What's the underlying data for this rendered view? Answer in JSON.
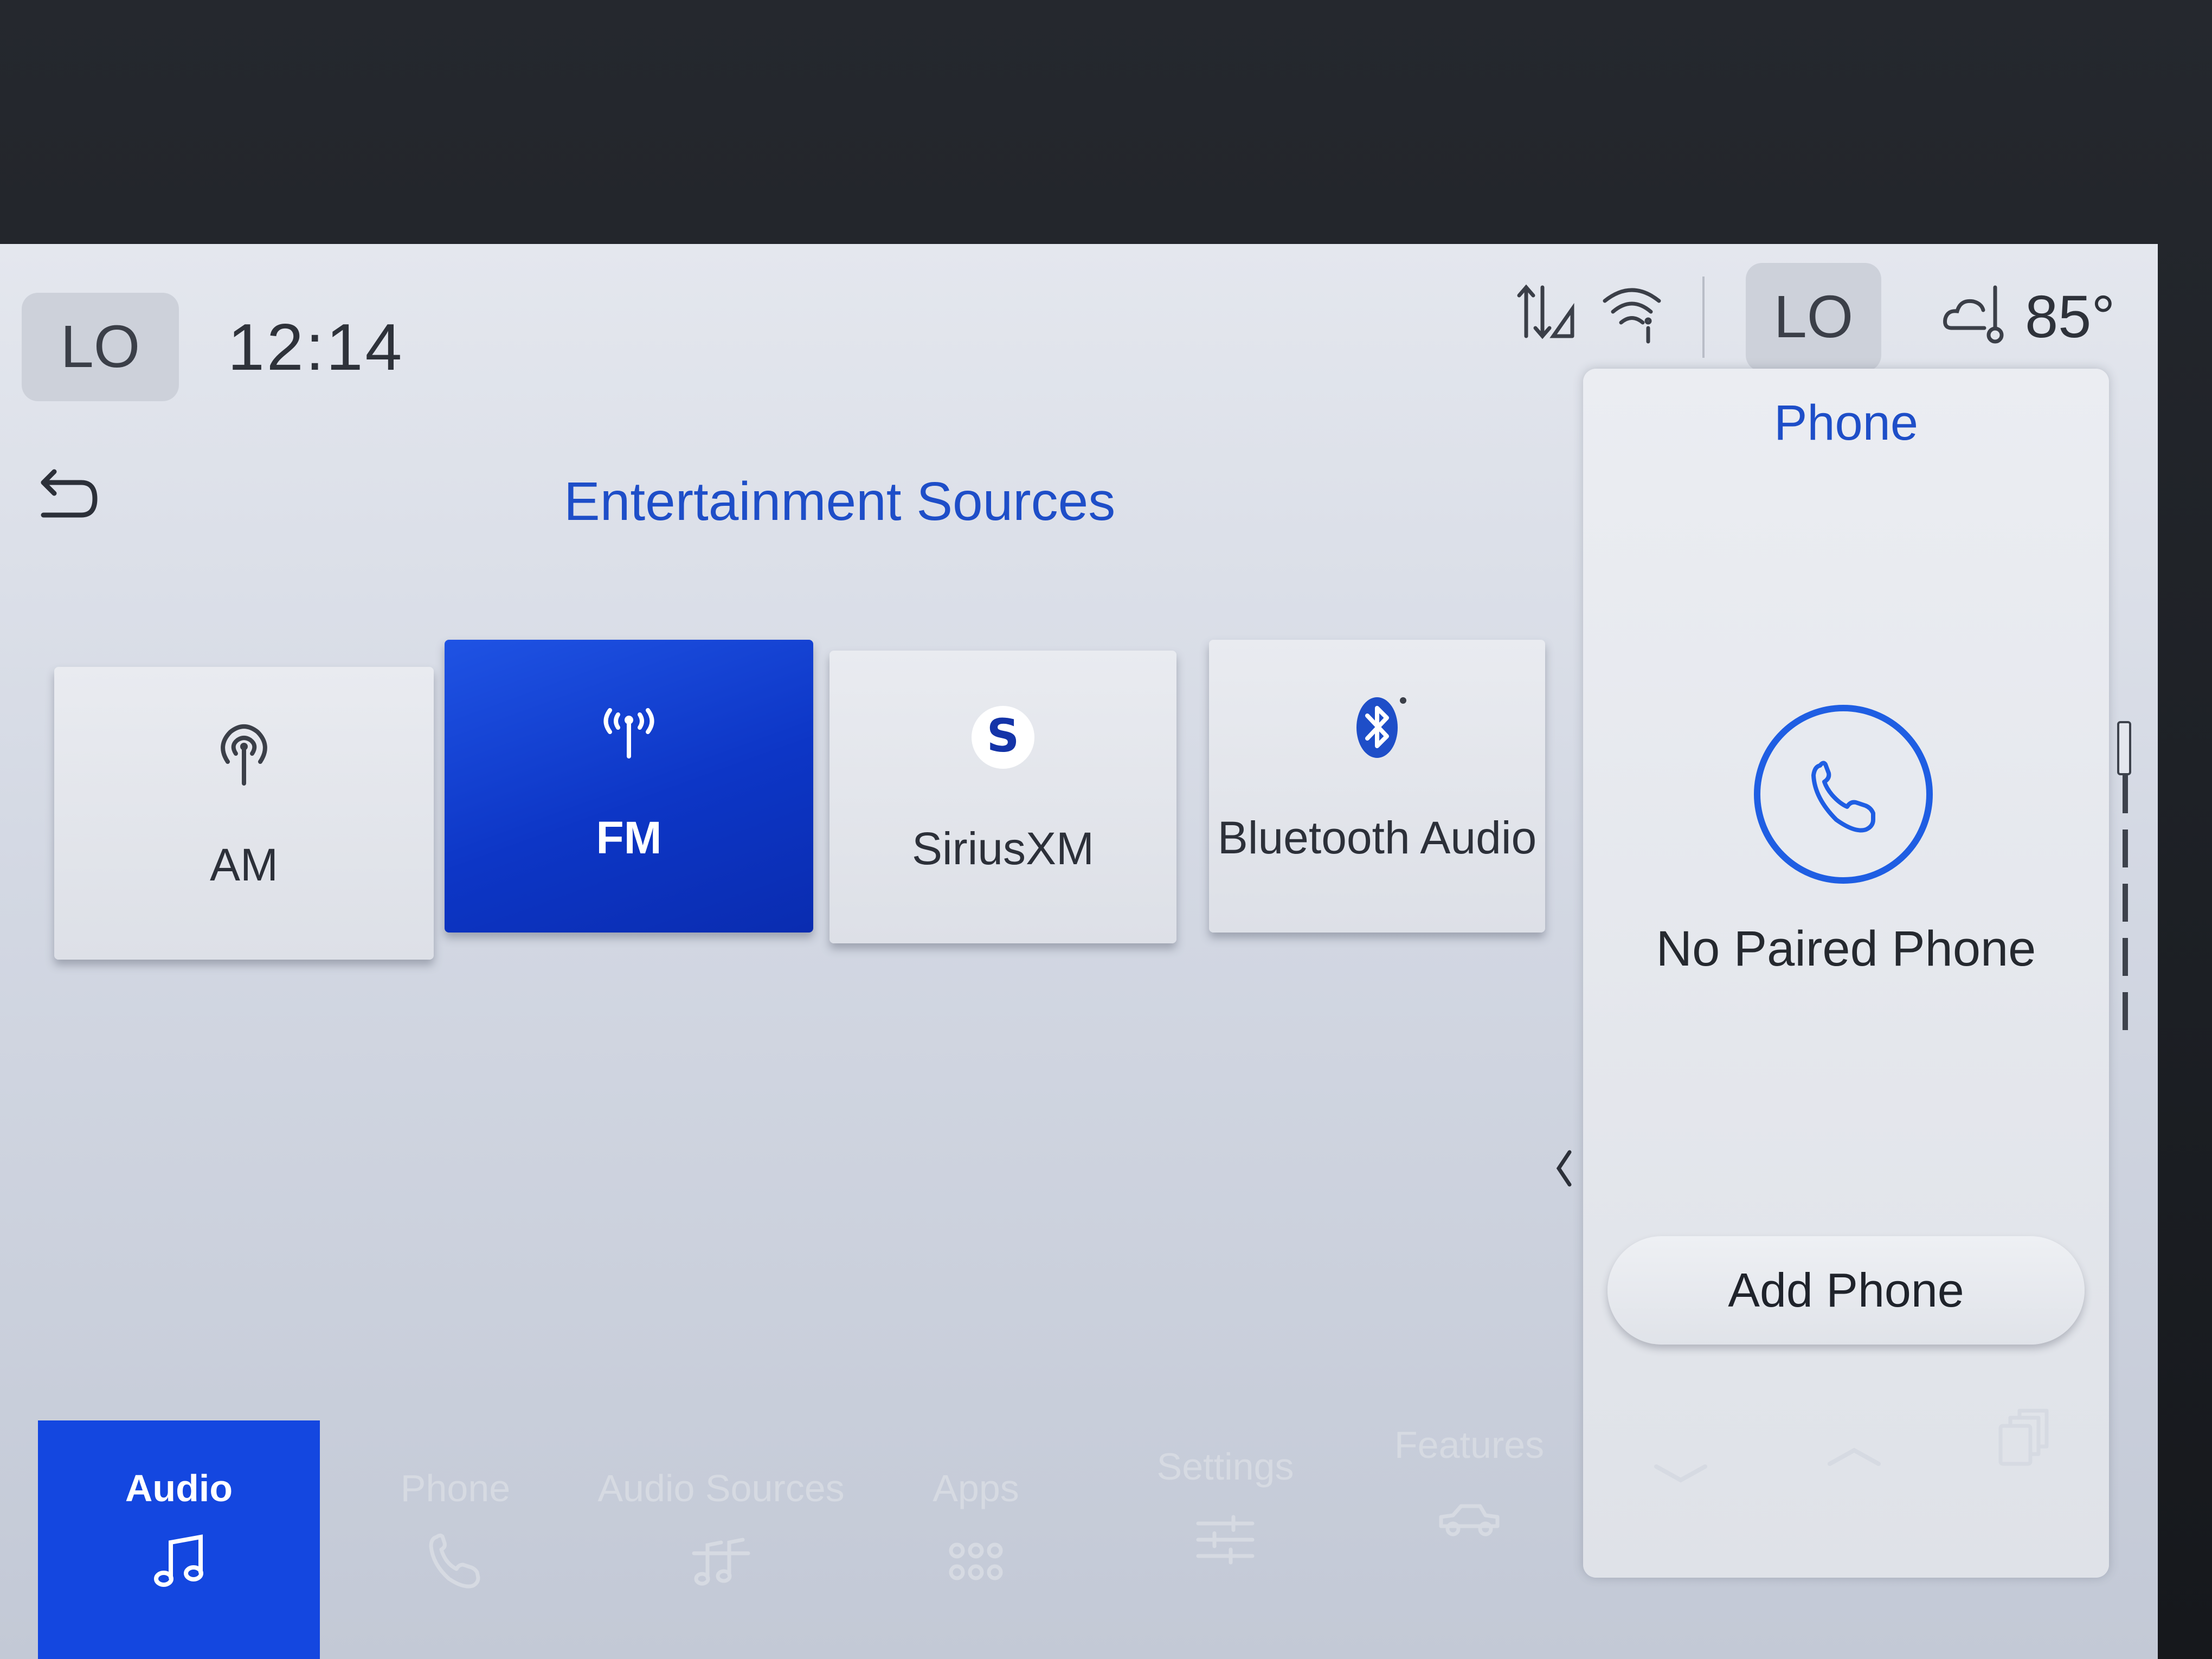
{
  "status_bar": {
    "climate_left": "LO",
    "time": "12:14",
    "climate_right": "LO",
    "temperature": "85°",
    "icons": [
      "data-transfer-icon",
      "wifi-info-icon",
      "weather-thermometer-icon"
    ]
  },
  "main": {
    "title": "Entertainment Sources",
    "back_icon": "back-arrow-icon",
    "sources": [
      {
        "label": "AM",
        "icon": "antenna-icon",
        "selected": false
      },
      {
        "label": "FM",
        "icon": "radio-signal-icon",
        "selected": true
      },
      {
        "label": "SiriusXM",
        "icon": "siriusxm-logo-icon",
        "selected": false
      },
      {
        "label": "Bluetooth Audio",
        "icon": "bluetooth-icon",
        "selected": false
      }
    ]
  },
  "phone_panel": {
    "title": "Phone",
    "status": "No Paired Phone",
    "add_button": "Add Phone",
    "icon": "phone-icon"
  },
  "bottom_nav": {
    "items": [
      {
        "label": "Audio",
        "icon": "music-note-icon",
        "active": true
      },
      {
        "label": "Phone",
        "icon": "phone-icon",
        "active": false
      },
      {
        "label": "Audio Sources",
        "icon": "audio-sources-icon",
        "active": false
      },
      {
        "label": "Apps",
        "icon": "apps-grid-icon",
        "active": false
      },
      {
        "label": "Settings",
        "icon": "sliders-icon",
        "active": false
      },
      {
        "label": "Features",
        "icon": "vehicle-icon",
        "active": false
      }
    ],
    "extra_icons": [
      "chevron-down-icon",
      "chevron-up-icon",
      "cards-icon"
    ]
  },
  "colors": {
    "accent": "#1f5ee3",
    "selected_tile": "#0d36c6",
    "title_blue": "#1e4ec8",
    "screen_bg": "#d3d8e3",
    "bezel": "#1d2026"
  }
}
